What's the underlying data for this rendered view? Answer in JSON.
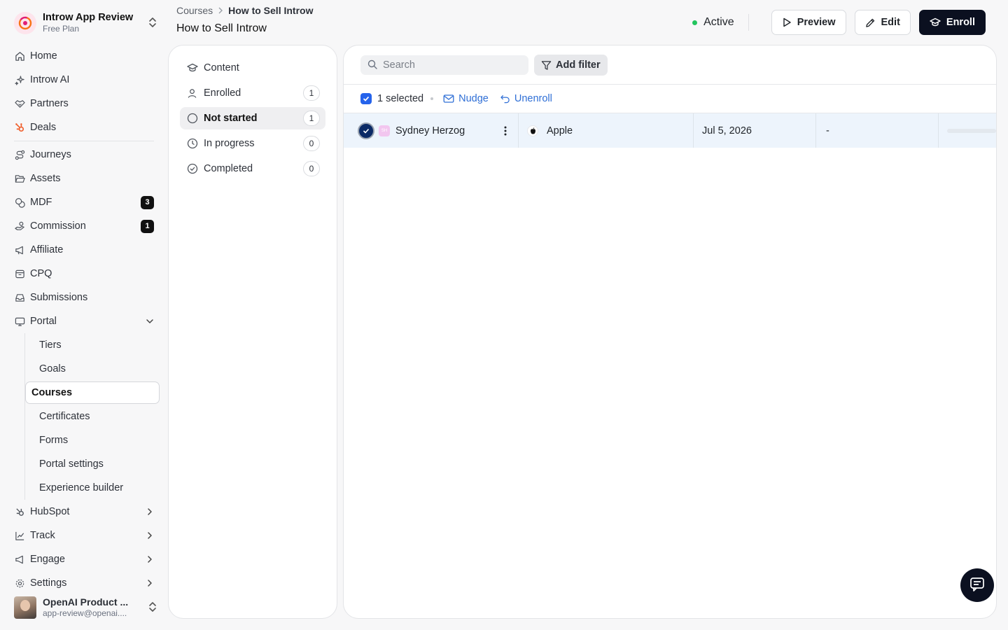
{
  "workspace": {
    "name": "Introw App Review",
    "plan": "Free Plan"
  },
  "nav": {
    "home": "Home",
    "introw_ai": "Introw AI",
    "partners": "Partners",
    "deals": "Deals",
    "journeys": "Journeys",
    "assets": "Assets",
    "mdf": "MDF",
    "mdf_badge": "3",
    "commission": "Commission",
    "commission_badge": "1",
    "affiliate": "Affiliate",
    "cpq": "CPQ",
    "submissions": "Submissions",
    "portal": "Portal",
    "portal_items": [
      "Tiers",
      "Goals",
      "Courses",
      "Certificates",
      "Forms",
      "Portal settings",
      "Experience builder"
    ],
    "hubspot": "HubSpot",
    "track": "Track",
    "engage": "Engage",
    "settings": "Settings"
  },
  "user": {
    "name": "OpenAI Product ...",
    "email": "app-review@openai...."
  },
  "breadcrumb": {
    "parent": "Courses",
    "current": "How to Sell Introw"
  },
  "page_title": "How to Sell Introw",
  "header": {
    "status": "Active",
    "status_color": "#22c55e",
    "preview": "Preview",
    "edit": "Edit",
    "enroll": "Enroll"
  },
  "tabs": [
    {
      "label": "Content",
      "icon": "graduation-cap-icon"
    },
    {
      "label": "Enrolled",
      "count": "1",
      "icon": "user-icon"
    },
    {
      "label": "Not started",
      "count": "1",
      "icon": "circle-icon"
    },
    {
      "label": "In progress",
      "count": "0",
      "icon": "clock-icon"
    },
    {
      "label": "Completed",
      "count": "0",
      "icon": "check-circle-icon"
    }
  ],
  "toolbar": {
    "search_placeholder": "Search",
    "add_filter": "Add filter"
  },
  "selection": {
    "text": "1 selected",
    "nudge": "Nudge",
    "unenroll": "Unenroll"
  },
  "rows": [
    {
      "initials": "SH",
      "name": "Sydney Herzog",
      "company": "Apple",
      "date": "Jul 5, 2026",
      "progress": "-"
    }
  ],
  "colors": {
    "accent": "#2563eb",
    "primary_button": "#0b1020",
    "selected_row": "#edf4fc"
  }
}
